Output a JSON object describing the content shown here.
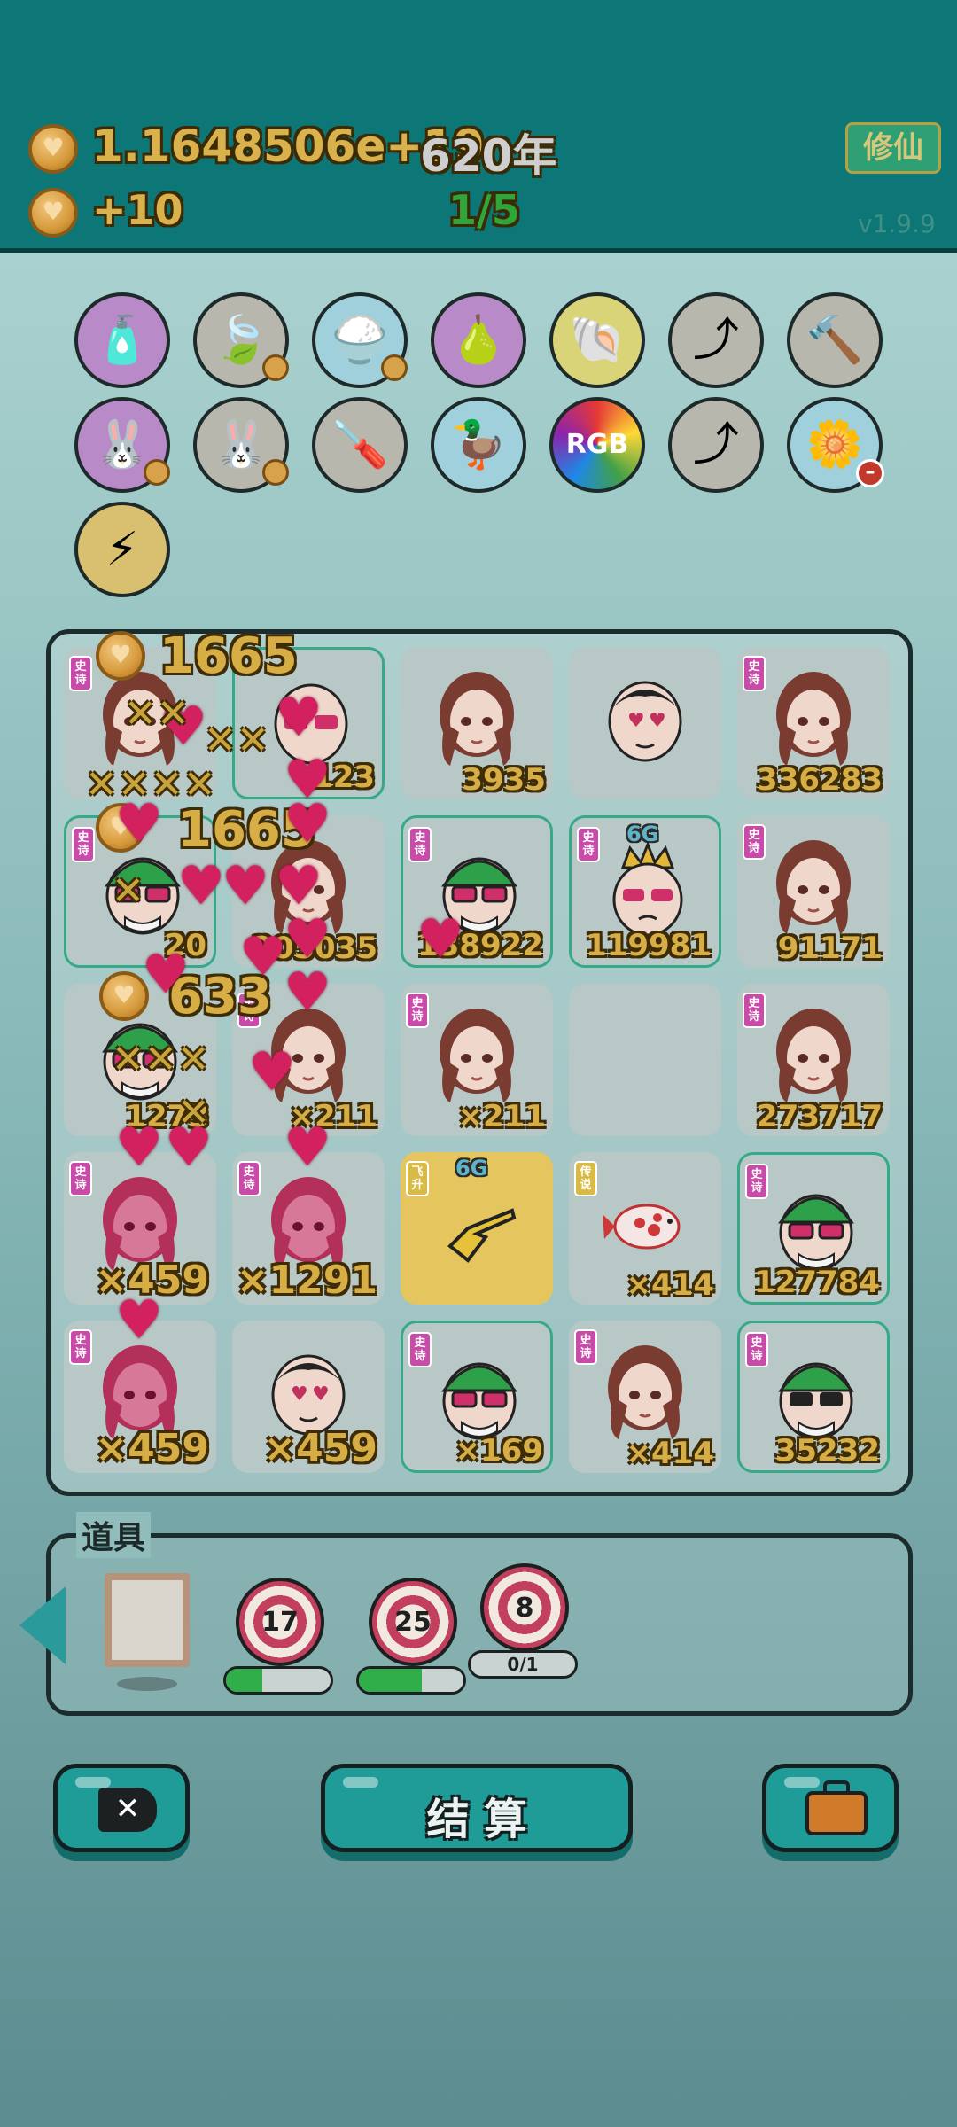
{
  "header": {
    "coins": "1.1648506e+19",
    "years": "620年",
    "income": "+10",
    "progress": "1/5",
    "xiuxian_label": "修仙",
    "version": "v1.9.9"
  },
  "icons": [
    {
      "name": "spray-bottle-icon",
      "color": "#b98ac8",
      "glyph": "🧴"
    },
    {
      "name": "leaf-icon",
      "color": "#b7b7ae",
      "glyph": "🍃"
    },
    {
      "name": "rice-bowl-icon",
      "color": "#9fd0dc",
      "glyph": "🍚"
    },
    {
      "name": "pomelo-icon",
      "color": "#b98ac8",
      "glyph": "🍐"
    },
    {
      "name": "shell-icon",
      "color": "#d8d477",
      "glyph": "🐚"
    },
    {
      "name": "upgrade-arrow-icon",
      "color": "#b7b7ae",
      "glyph": "⤴"
    },
    {
      "name": "hammer-icon",
      "color": "#b7b7ae",
      "glyph": "🔨"
    },
    {
      "name": "rabbit-icon",
      "color": "#b98ac8",
      "glyph": "🐰"
    },
    {
      "name": "rabbit-icon",
      "color": "#b7b7ae",
      "glyph": "🐰"
    },
    {
      "name": "screwdriver-icon",
      "color": "#b7b7ae",
      "glyph": "🪛"
    },
    {
      "name": "duck-pot-icon",
      "color": "#9fd0dc",
      "glyph": "🦆"
    },
    {
      "name": "rgb-icon",
      "color": "#c04070",
      "glyph": "RGB"
    },
    {
      "name": "upgrade-arrow-icon",
      "color": "#b7b7ae",
      "glyph": "⤴"
    },
    {
      "name": "flower-pot-icon",
      "color": "#9fd0dc",
      "glyph": "🌼"
    },
    {
      "name": "lightning-icon",
      "color": "#d8c070",
      "glyph": "⚡"
    }
  ],
  "board": {
    "cells": [
      {
        "tag": "史诗",
        "value": "",
        "face": "girl"
      },
      {
        "tag": "",
        "value": "123",
        "face": "glasses"
      },
      {
        "tag": "",
        "value": "3935",
        "face": "girl"
      },
      {
        "tag": "",
        "value": "",
        "face": "boy"
      },
      {
        "tag": "史诗",
        "value": "336283",
        "face": "girl"
      },
      {
        "tag": "史诗",
        "value": "20",
        "face": "greenhat"
      },
      {
        "tag": "",
        "value": "205035",
        "face": "girl"
      },
      {
        "tag": "史诗",
        "value": "138922",
        "face": "greenhat"
      },
      {
        "tag": "史诗",
        "value": "119981",
        "face": "king",
        "level": "6G"
      },
      {
        "tag": "史诗",
        "value": "91171",
        "face": "girl"
      },
      {
        "tag": "",
        "value": "1273",
        "face": "greenhat"
      },
      {
        "tag": "史诗",
        "value": "×211",
        "face": "girl"
      },
      {
        "tag": "史诗",
        "value": "×211",
        "face": "girl"
      },
      {
        "tag": "",
        "value": "",
        "face": ""
      },
      {
        "tag": "史诗",
        "value": "273717",
        "face": "girl"
      },
      {
        "tag": "史诗",
        "value": "×459",
        "face": "pinkgirl"
      },
      {
        "tag": "史诗",
        "value": "×1291",
        "face": "pinkgirl"
      },
      {
        "tag": "飞升",
        "value": "",
        "face": "hand",
        "level": "6G"
      },
      {
        "tag": "传说",
        "value": "×414",
        "face": "fish"
      },
      {
        "tag": "史诗",
        "value": "127784",
        "face": "greenhat"
      },
      {
        "tag": "史诗",
        "value": "×459",
        "face": "pinkgirl"
      },
      {
        "tag": "",
        "value": "×459",
        "face": "boy"
      },
      {
        "tag": "史诗",
        "value": "×169",
        "face": "greenhat"
      },
      {
        "tag": "史诗",
        "value": "×414",
        "face": "girl"
      },
      {
        "tag": "史诗",
        "value": "35232",
        "face": "sunglasses"
      }
    ],
    "fx_numbers": [
      "1665",
      "1665",
      "633"
    ]
  },
  "tools": {
    "title": "道具",
    "targets": [
      {
        "value": "17",
        "progress": 0.35
      },
      {
        "value": "25",
        "progress": 0.6
      },
      {
        "value": "8",
        "progress_label": "0/1"
      }
    ]
  },
  "buttons": {
    "settle_label": "结 算"
  }
}
